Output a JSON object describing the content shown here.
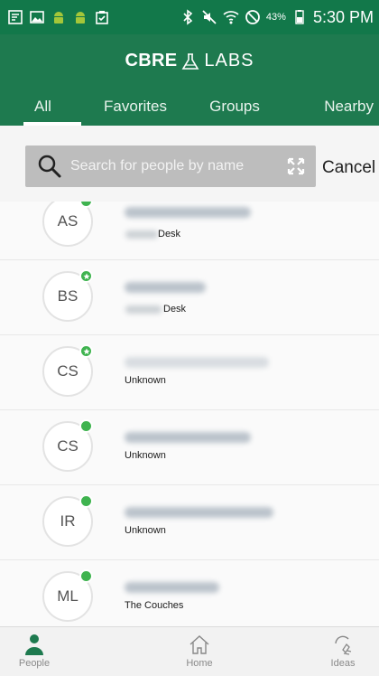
{
  "status_bar": {
    "battery_percent": "43%",
    "time": "5:30 PM",
    "icons": [
      "notification-icon",
      "image-icon",
      "android-icon",
      "android-icon",
      "clipboard-check-icon",
      "bluetooth-icon",
      "mute-icon",
      "wifi-icon",
      "block-icon",
      "battery-icon"
    ]
  },
  "header": {
    "brand": "CBRE",
    "sub_brand": "LABS",
    "tabs": [
      {
        "label": "All",
        "active": true
      },
      {
        "label": "Favorites",
        "active": false
      },
      {
        "label": "Groups",
        "active": false
      },
      {
        "label": "Nearby",
        "active": false
      }
    ]
  },
  "search": {
    "placeholder": "Search for people by name",
    "value": "",
    "cancel_label": "Cancel"
  },
  "people": [
    {
      "initials": "AS",
      "location": "Desk",
      "status": "available",
      "favorite": false
    },
    {
      "initials": "BS",
      "location": "Desk",
      "status": "available",
      "favorite": true
    },
    {
      "initials": "CS",
      "location": "Unknown",
      "status": "available",
      "favorite": true
    },
    {
      "initials": "CS",
      "location": "Unknown",
      "status": "available",
      "favorite": false
    },
    {
      "initials": "IR",
      "location": "Unknown",
      "status": "available",
      "favorite": false
    },
    {
      "initials": "ML",
      "location": "The Couches",
      "status": "available",
      "favorite": false
    }
  ],
  "bottom_nav": [
    {
      "label": "People",
      "icon": "person-icon",
      "active": true
    },
    {
      "label": "Home",
      "icon": "home-icon",
      "active": false
    },
    {
      "label": "Ideas",
      "icon": "lightbulb-icon",
      "active": false
    }
  ],
  "colors": {
    "status_bar": "#12784a",
    "header": "#1e7a4f",
    "presence": "#3fb34f",
    "search_box": "#bdbdbd"
  }
}
